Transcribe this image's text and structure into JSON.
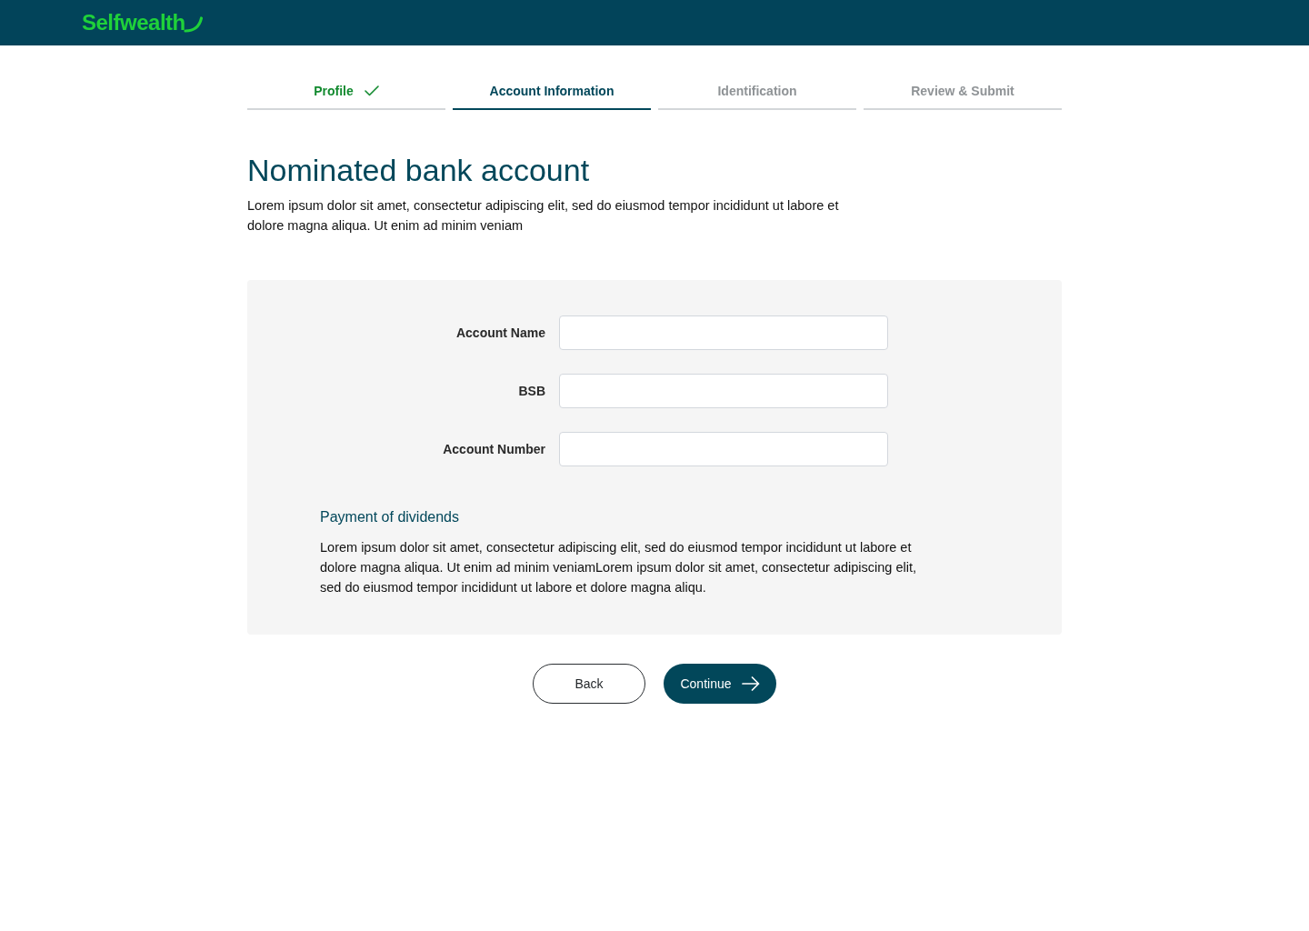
{
  "header": {
    "logo": "Selfwealth"
  },
  "steps": [
    {
      "label": "Profile",
      "completed": true,
      "selected": false
    },
    {
      "label": "Account Information",
      "completed": false,
      "selected": true
    },
    {
      "label": "Identification",
      "completed": false,
      "selected": false
    },
    {
      "label": "Review & Submit",
      "completed": false,
      "selected": false
    }
  ],
  "page": {
    "title": "Nominated bank account",
    "intro": "Lorem ipsum dolor sit amet, consectetur adipiscing elit, sed do eiusmod tempor incididunt ut labore et dolore magna aliqua. Ut enim ad minim veniam"
  },
  "form": {
    "fields": [
      {
        "label": "Account Name"
      },
      {
        "label": "BSB"
      },
      {
        "label": "Account Number"
      }
    ],
    "dividends": {
      "title": "Payment of dividends",
      "text": "Lorem ipsum dolor sit amet, consectetur adipiscing elit, sed do eiusmod tempor incididunt ut labore et dolore magna aliqua. Ut enim ad minim veniamLorem ipsum dolor sit amet, consectetur adipiscing elit, sed do eiusmod tempor incididunt ut labore et dolore magna aliqu."
    }
  },
  "buttons": [
    {
      "label": "Back",
      "kind": "secondary"
    },
    {
      "label": "Continue",
      "kind": "primary"
    }
  ]
}
